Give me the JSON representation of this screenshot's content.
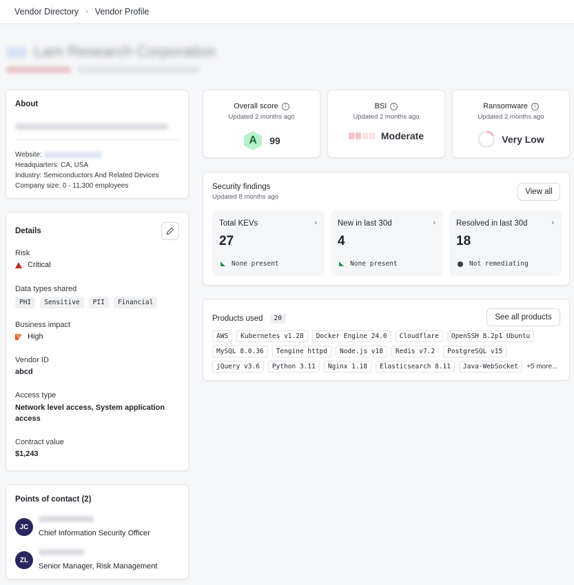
{
  "breadcrumb": {
    "parent": "Vendor Directory",
    "current": "Vendor Profile"
  },
  "vendor": {
    "name": "Lam Research Corporation"
  },
  "about": {
    "title": "About",
    "website_label": "Website:",
    "hq_label": "Headquarters:",
    "hq_value": "CA, USA",
    "industry_label": "Industry:",
    "industry_value": "Semiconductors And Related Devices",
    "size_label": "Company size:",
    "size_value": "0 - 11,300 employees"
  },
  "details": {
    "title": "Details",
    "risk_label": "Risk",
    "risk_value": "Critical",
    "risk_color": "#c62828",
    "data_types_label": "Data types shared",
    "data_types": [
      "PHI",
      "Sensitive",
      "PII",
      "Financial"
    ],
    "impact_label": "Business impact",
    "impact_value": "High",
    "impact_color": "#e8590c",
    "vendor_id_label": "Vendor ID",
    "vendor_id_value": "abcd",
    "access_label": "Access type",
    "access_value": "Network level access, System application access",
    "contract_label": "Contract value",
    "contract_value": "$1,243"
  },
  "contacts": {
    "title": "Points of contact (2)",
    "people": [
      {
        "initials": "JC",
        "role": "Chief Information Security Officer"
      },
      {
        "initials": "ZL",
        "role": "Senior Manager, Risk Management"
      }
    ]
  },
  "scores": {
    "overall": {
      "title": "Overall score",
      "updated": "Updated 2 months ago",
      "grade": "A",
      "value": "99"
    },
    "bsi": {
      "title": "BSI",
      "updated": "Updated 2 months ago",
      "value": "Moderate"
    },
    "ransomware": {
      "title": "Ransomware",
      "updated": "Updated 2 months ago",
      "value": "Very Low"
    }
  },
  "findings": {
    "title": "Security findings",
    "updated": "Updated 8 months ago",
    "view_all": "View all",
    "tiles": [
      {
        "label": "Total KEVs",
        "value": "27",
        "status": "None present"
      },
      {
        "label": "New in last 30d",
        "value": "4",
        "status": "None present"
      },
      {
        "label": "Resolved in last 30d",
        "value": "18",
        "status": "Not remediating"
      }
    ]
  },
  "products": {
    "title": "Products used",
    "count": "20",
    "see_all": "See all products",
    "row1": [
      "AWS",
      "Kubernetes v1.28",
      "Docker Engine 24.0",
      "Cloudflare",
      "OpenSSH 8.2p1 Ubuntu"
    ],
    "row2": [
      "MySQL 8.0.36",
      "Tengine httpd",
      "Node.js v18",
      "Redis v7.2",
      "PostgreSQL v15"
    ],
    "row3": [
      "jQuery v3.6",
      "Python 3.11",
      "Nginx 1.18",
      "Elasticsearch 8.11",
      "Java-WebSocket"
    ],
    "more": "+5 more..."
  },
  "icons": {
    "chevron": "chevron-right-icon",
    "info": "info-icon",
    "edit": "pencil-icon"
  }
}
